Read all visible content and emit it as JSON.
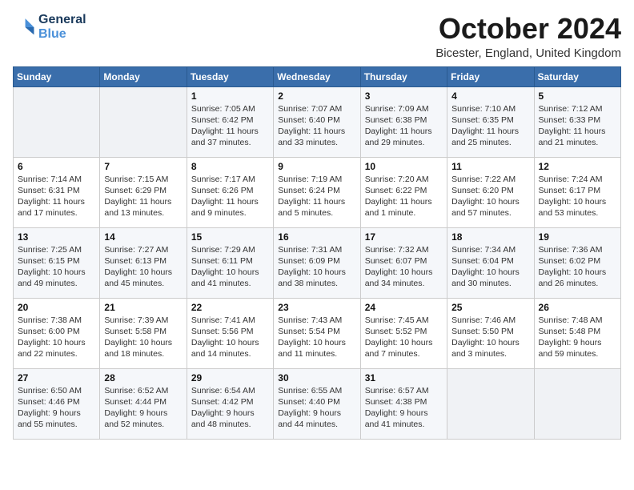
{
  "header": {
    "logo_line1": "General",
    "logo_line2": "Blue",
    "month": "October 2024",
    "location": "Bicester, England, United Kingdom"
  },
  "weekdays": [
    "Sunday",
    "Monday",
    "Tuesday",
    "Wednesday",
    "Thursday",
    "Friday",
    "Saturday"
  ],
  "weeks": [
    [
      {
        "day": "",
        "info": ""
      },
      {
        "day": "",
        "info": ""
      },
      {
        "day": "1",
        "info": "Sunrise: 7:05 AM\nSunset: 6:42 PM\nDaylight: 11 hours and 37 minutes."
      },
      {
        "day": "2",
        "info": "Sunrise: 7:07 AM\nSunset: 6:40 PM\nDaylight: 11 hours and 33 minutes."
      },
      {
        "day": "3",
        "info": "Sunrise: 7:09 AM\nSunset: 6:38 PM\nDaylight: 11 hours and 29 minutes."
      },
      {
        "day": "4",
        "info": "Sunrise: 7:10 AM\nSunset: 6:35 PM\nDaylight: 11 hours and 25 minutes."
      },
      {
        "day": "5",
        "info": "Sunrise: 7:12 AM\nSunset: 6:33 PM\nDaylight: 11 hours and 21 minutes."
      }
    ],
    [
      {
        "day": "6",
        "info": "Sunrise: 7:14 AM\nSunset: 6:31 PM\nDaylight: 11 hours and 17 minutes."
      },
      {
        "day": "7",
        "info": "Sunrise: 7:15 AM\nSunset: 6:29 PM\nDaylight: 11 hours and 13 minutes."
      },
      {
        "day": "8",
        "info": "Sunrise: 7:17 AM\nSunset: 6:26 PM\nDaylight: 11 hours and 9 minutes."
      },
      {
        "day": "9",
        "info": "Sunrise: 7:19 AM\nSunset: 6:24 PM\nDaylight: 11 hours and 5 minutes."
      },
      {
        "day": "10",
        "info": "Sunrise: 7:20 AM\nSunset: 6:22 PM\nDaylight: 11 hours and 1 minute."
      },
      {
        "day": "11",
        "info": "Sunrise: 7:22 AM\nSunset: 6:20 PM\nDaylight: 10 hours and 57 minutes."
      },
      {
        "day": "12",
        "info": "Sunrise: 7:24 AM\nSunset: 6:17 PM\nDaylight: 10 hours and 53 minutes."
      }
    ],
    [
      {
        "day": "13",
        "info": "Sunrise: 7:25 AM\nSunset: 6:15 PM\nDaylight: 10 hours and 49 minutes."
      },
      {
        "day": "14",
        "info": "Sunrise: 7:27 AM\nSunset: 6:13 PM\nDaylight: 10 hours and 45 minutes."
      },
      {
        "day": "15",
        "info": "Sunrise: 7:29 AM\nSunset: 6:11 PM\nDaylight: 10 hours and 41 minutes."
      },
      {
        "day": "16",
        "info": "Sunrise: 7:31 AM\nSunset: 6:09 PM\nDaylight: 10 hours and 38 minutes."
      },
      {
        "day": "17",
        "info": "Sunrise: 7:32 AM\nSunset: 6:07 PM\nDaylight: 10 hours and 34 minutes."
      },
      {
        "day": "18",
        "info": "Sunrise: 7:34 AM\nSunset: 6:04 PM\nDaylight: 10 hours and 30 minutes."
      },
      {
        "day": "19",
        "info": "Sunrise: 7:36 AM\nSunset: 6:02 PM\nDaylight: 10 hours and 26 minutes."
      }
    ],
    [
      {
        "day": "20",
        "info": "Sunrise: 7:38 AM\nSunset: 6:00 PM\nDaylight: 10 hours and 22 minutes."
      },
      {
        "day": "21",
        "info": "Sunrise: 7:39 AM\nSunset: 5:58 PM\nDaylight: 10 hours and 18 minutes."
      },
      {
        "day": "22",
        "info": "Sunrise: 7:41 AM\nSunset: 5:56 PM\nDaylight: 10 hours and 14 minutes."
      },
      {
        "day": "23",
        "info": "Sunrise: 7:43 AM\nSunset: 5:54 PM\nDaylight: 10 hours and 11 minutes."
      },
      {
        "day": "24",
        "info": "Sunrise: 7:45 AM\nSunset: 5:52 PM\nDaylight: 10 hours and 7 minutes."
      },
      {
        "day": "25",
        "info": "Sunrise: 7:46 AM\nSunset: 5:50 PM\nDaylight: 10 hours and 3 minutes."
      },
      {
        "day": "26",
        "info": "Sunrise: 7:48 AM\nSunset: 5:48 PM\nDaylight: 9 hours and 59 minutes."
      }
    ],
    [
      {
        "day": "27",
        "info": "Sunrise: 6:50 AM\nSunset: 4:46 PM\nDaylight: 9 hours and 55 minutes."
      },
      {
        "day": "28",
        "info": "Sunrise: 6:52 AM\nSunset: 4:44 PM\nDaylight: 9 hours and 52 minutes."
      },
      {
        "day": "29",
        "info": "Sunrise: 6:54 AM\nSunset: 4:42 PM\nDaylight: 9 hours and 48 minutes."
      },
      {
        "day": "30",
        "info": "Sunrise: 6:55 AM\nSunset: 4:40 PM\nDaylight: 9 hours and 44 minutes."
      },
      {
        "day": "31",
        "info": "Sunrise: 6:57 AM\nSunset: 4:38 PM\nDaylight: 9 hours and 41 minutes."
      },
      {
        "day": "",
        "info": ""
      },
      {
        "day": "",
        "info": ""
      }
    ]
  ]
}
